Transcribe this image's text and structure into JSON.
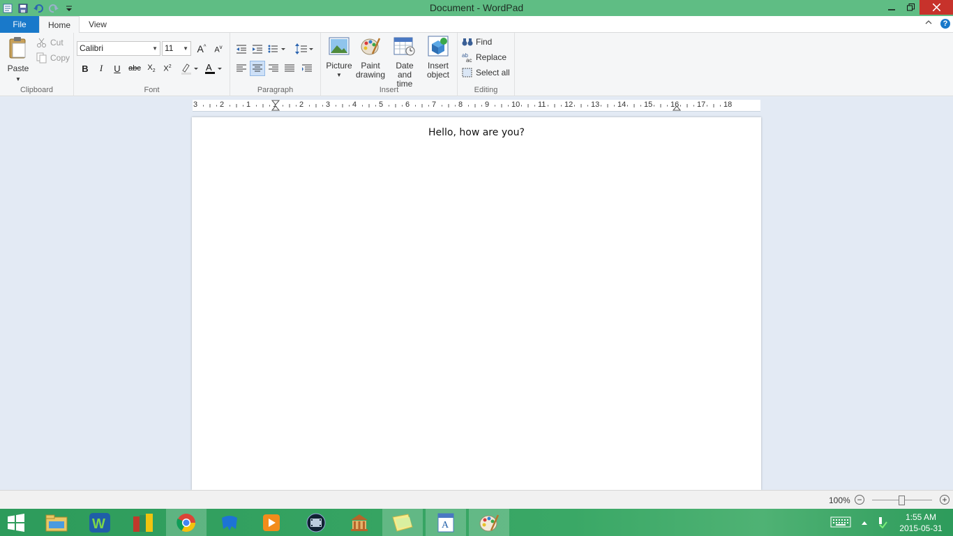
{
  "window": {
    "title": "Document - WordPad"
  },
  "quick_access": {
    "items": [
      "wordpad-app-icon",
      "save-icon",
      "undo-icon",
      "redo-icon",
      "customize-icon"
    ]
  },
  "tabs": {
    "file": "File",
    "home": "Home",
    "view": "View"
  },
  "clipboard": {
    "paste": "Paste",
    "cut": "Cut",
    "copy": "Copy",
    "label": "Clipboard"
  },
  "font": {
    "family": "Calibri",
    "size": "11",
    "label": "Font"
  },
  "paragraph": {
    "label": "Paragraph"
  },
  "insert": {
    "picture": "Picture",
    "paint_line1": "Paint",
    "paint_line2": "drawing",
    "date_line1": "Date and",
    "date_line2": "time",
    "object_line1": "Insert",
    "object_line2": "object",
    "label": "Insert"
  },
  "editing": {
    "find": "Find",
    "replace": "Replace",
    "select_all": "Select all",
    "label": "Editing"
  },
  "ruler": {
    "labels": [
      "3",
      "2",
      "1",
      "1",
      "2",
      "3",
      "4",
      "5",
      "6",
      "7",
      "8",
      "9",
      "10",
      "11",
      "12",
      "13",
      "14",
      "15",
      "16",
      "17",
      "18"
    ]
  },
  "document": {
    "text": "Hello, how are you?"
  },
  "status": {
    "zoom": "100%"
  },
  "taskbar": {
    "apps": [
      "file-explorer-icon",
      "wps-writer-icon",
      "winrar-icon",
      "chrome-icon",
      "malwarebytes-icon",
      "media-player-icon",
      "movie-maker-icon",
      "museum-app-icon",
      "sticky-notes-icon",
      "wordpad-icon",
      "paint-icon"
    ],
    "time": "1:55 AM",
    "date": "2015-05-31"
  },
  "colors": {
    "titlebar": "#5fbd84",
    "file_tab": "#1979ca",
    "close": "#c7322b",
    "taskbar": "#2d9b5b"
  }
}
